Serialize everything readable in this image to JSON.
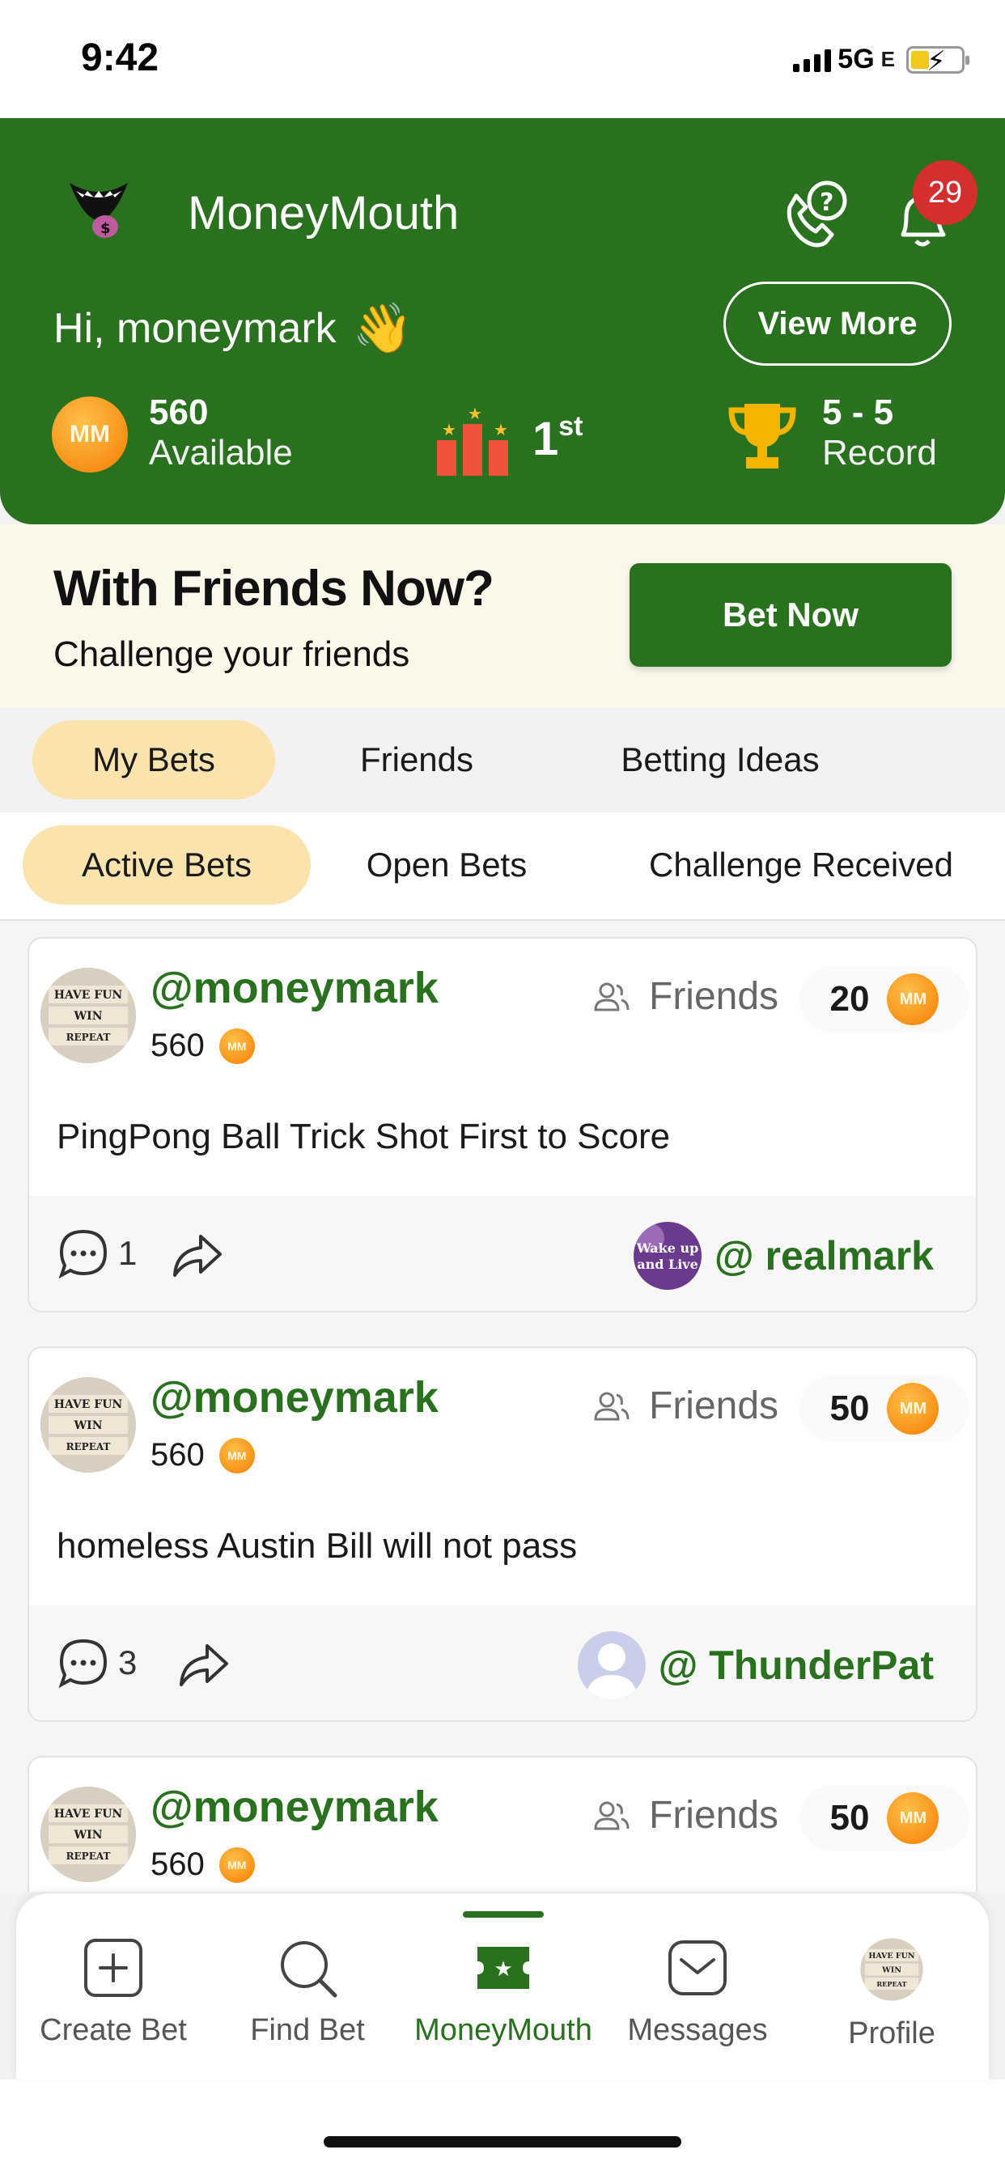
{
  "status_bar": {
    "time": "9:42",
    "network": "5G",
    "network_sub": "E"
  },
  "header": {
    "app_name": "MoneyMouth",
    "notification_count": "29",
    "greeting": "Hi, moneymark",
    "view_more_label": "View More",
    "available_value": "560",
    "available_label": "Available",
    "rank": "1",
    "rank_suffix": "st",
    "record_value": "5 - 5",
    "record_label": "Record",
    "coin_symbol": "MM"
  },
  "promo": {
    "title": "With Friends Now?",
    "subtitle": "Challenge your friends",
    "button_label": "Bet Now"
  },
  "main_tabs": [
    "My Bets",
    "Friends",
    "Betting Ideas"
  ],
  "sub_tabs": [
    "Active Bets",
    "Open Bets",
    "Challenge Received"
  ],
  "bets": [
    {
      "user": "@moneymark",
      "points": "560",
      "audience": "Friends",
      "stake": "20",
      "description": "PingPong Ball Trick Shot First to Score",
      "comments": "1",
      "opponent": "@ realmark"
    },
    {
      "user": "@moneymark",
      "points": "560",
      "audience": "Friends",
      "stake": "50",
      "description": "homeless Austin Bill will not pass",
      "comments": "3",
      "opponent": "@ ThunderPat"
    },
    {
      "user": "@moneymark",
      "points": "560",
      "audience": "Friends",
      "stake": "50",
      "description": "",
      "comments": "",
      "opponent": ""
    }
  ],
  "avatar_text": {
    "line1": "HAVE FUN",
    "line2": "WIN",
    "line3": "REPEAT"
  },
  "opponent_avatar_text": {
    "line1": "Wake up",
    "line2": "and Live"
  },
  "nav": [
    "Create Bet",
    "Find Bet",
    "MoneyMouth",
    "Messages",
    "Profile"
  ],
  "colors": {
    "brand_green": "#29701f",
    "active_tab": "#fbe3ad",
    "coin": "#f57d00",
    "badge_red": "#d32f2f"
  }
}
